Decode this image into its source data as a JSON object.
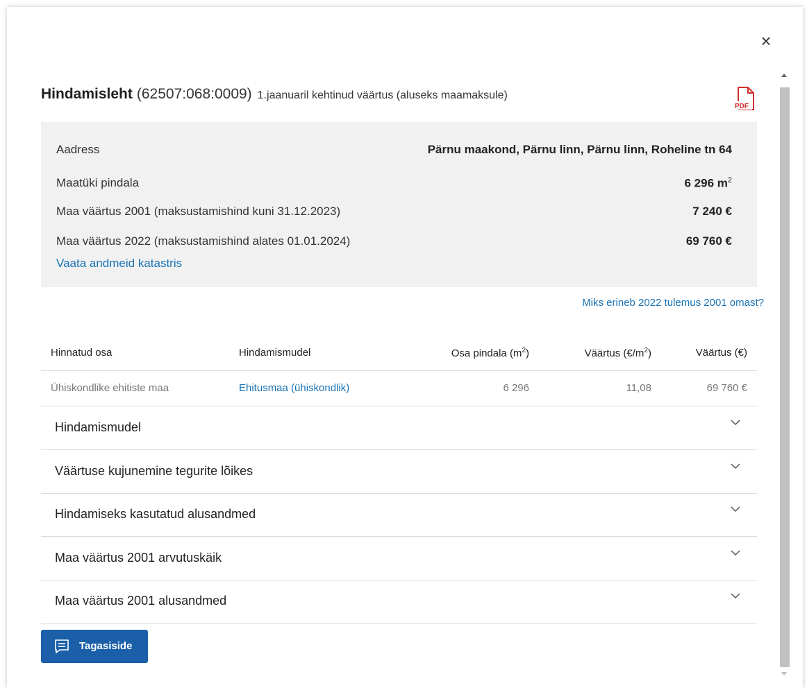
{
  "dialog": {
    "close_symbol": "×",
    "title_main": "Hindamisleht",
    "title_code": "(62507:068:0009)",
    "title_sub": "1.jaanuaril kehtinud väärtus (aluseks maamaksule)",
    "pdf_label": "PDF"
  },
  "summary": {
    "rows": [
      {
        "key": "Aadress",
        "value": "Pärnu maakond, Pärnu linn, Pärnu linn, Roheline tn 64"
      },
      {
        "key": "Maatüki pindala",
        "value": "6 296 m",
        "sup": "2"
      },
      {
        "key": "Maa väärtus 2001 (maksustamishind kuni 31.12.2023)",
        "value": "7 240 €"
      },
      {
        "key": "Maa väärtus 2022 (maksustamishind alates 01.01.2024)",
        "value": "69 760 €"
      }
    ],
    "cadastre_link": "Vaata andmeid katastris"
  },
  "why_link": "Miks erineb 2022 tulemus 2001 omast?",
  "table": {
    "headers": {
      "part": "Hinnatud osa",
      "model": "Hindamismudel",
      "area": "Osa pindala (m",
      "area_sup": "2",
      "area_end": ")",
      "value_per_m": "Väärtus (€/m",
      "value_per_m_sup": "2",
      "value_per_m_end": ")",
      "value": "Väärtus (€)"
    },
    "rows": [
      {
        "part": "Ühiskondlike ehitiste maa",
        "model": "Ehitusmaa (ühiskondlik)",
        "area": "6 296",
        "value_per_m": "11,08",
        "value": "69 760 €"
      }
    ]
  },
  "accordions": [
    "Hindamismudel",
    "Väärtuse kujunemine tegurite lõikes",
    "Hindamiseks kasutatud alusandmed",
    "Maa väärtus 2001 arvutuskäik",
    "Maa väärtus 2001 alusandmed"
  ],
  "feedback_button": "Tagasiside",
  "colors": {
    "link": "#1a73b5",
    "button": "#1a5fa8",
    "pdf_red": "#d32f2f"
  }
}
